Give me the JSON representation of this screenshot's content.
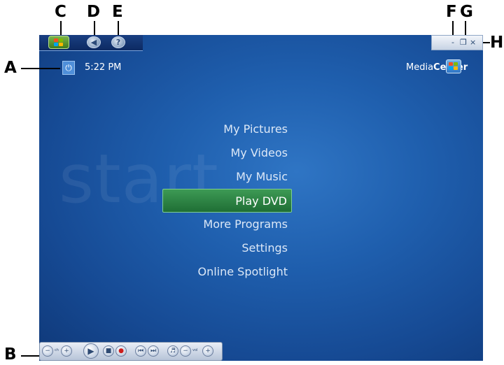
{
  "callouts": {
    "a": "A",
    "b": "B",
    "c": "C",
    "d": "D",
    "e": "E",
    "f": "F",
    "g": "G",
    "h": "H"
  },
  "status": {
    "power_glyph": "⏻",
    "time": "5:22 PM"
  },
  "brand": {
    "media": "Media",
    "center": "Center"
  },
  "watermark": "start",
  "menu": {
    "items": [
      {
        "label": "My Pictures"
      },
      {
        "label": "My Videos"
      },
      {
        "label": "My Music"
      },
      {
        "label": "Play DVD",
        "selected": true
      },
      {
        "label": "More Programs"
      },
      {
        "label": "Settings"
      },
      {
        "label": "Online Spotlight"
      }
    ]
  },
  "toolbar": {
    "back_icon": "back-arrow-icon",
    "help_icon": "question-mark-icon",
    "start_icon": "windows-flag-icon"
  },
  "window_controls": {
    "minimize": "-",
    "restore": "❐",
    "close": "×"
  },
  "transport": {
    "ch_label": "ch",
    "vol_label": "vol"
  },
  "colors": {
    "background": "#1f5fae",
    "selected_item": "#2e8a47",
    "text": "#dce8f7"
  }
}
